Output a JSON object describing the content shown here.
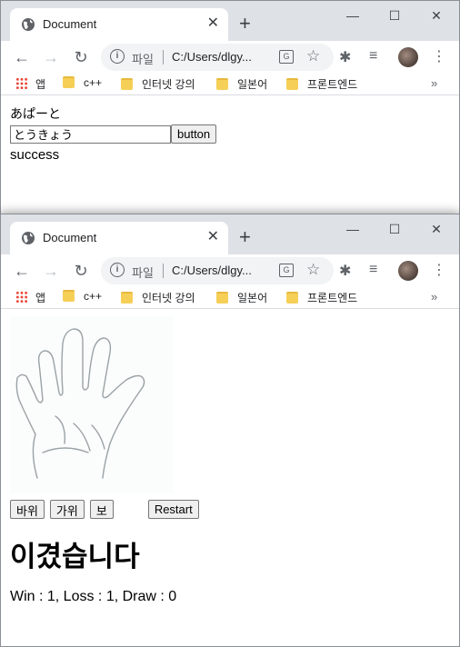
{
  "colors": {
    "tabstrip": "#dee1e6",
    "accent": "#1a73e8",
    "folder": "#f6cf57"
  },
  "windows": [
    {
      "tab": {
        "title": "Document",
        "icon": "globe-icon",
        "close": "✕"
      },
      "url_prefix": "파일",
      "url": "C:/Users/dlgy...",
      "bookmarks": [
        "앱",
        "c++",
        "인터넷 강의",
        "일본어",
        "프론트엔드"
      ],
      "page": {
        "label": "あぱーと",
        "input_value": "とうきょう",
        "button": "button",
        "status": "success"
      }
    },
    {
      "tab": {
        "title": "Document",
        "icon": "globe-icon",
        "close": "✕"
      },
      "url_prefix": "파일",
      "url": "C:/Users/dlgy...",
      "bookmarks": [
        "앱",
        "c++",
        "인터넷 강의",
        "일본어",
        "프론트엔드"
      ],
      "page": {
        "image": "hand-paper-image",
        "buttons": [
          "바위",
          "가위",
          "보"
        ],
        "restart": "Restart",
        "result": "이겼습니다",
        "score": "Win : 1, Loss : 1, Draw : 0"
      }
    }
  ]
}
